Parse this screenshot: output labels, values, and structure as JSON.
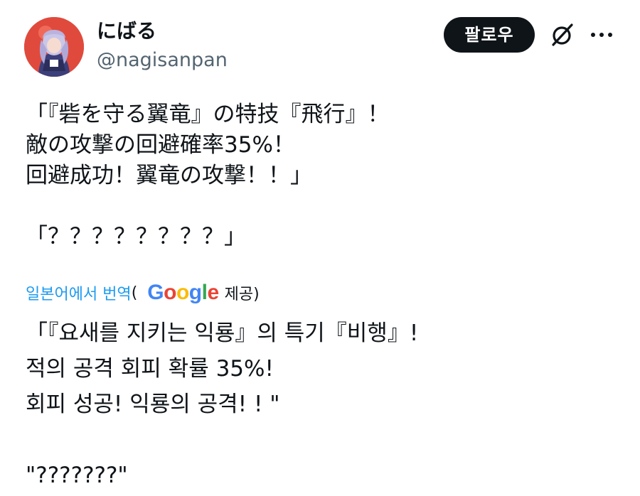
{
  "user": {
    "display_name": "にばる",
    "handle": "@nagisanpan"
  },
  "actions": {
    "follow_label": "팔로우",
    "grok_icon": "grok-slash-icon",
    "more_icon": "more-horizontal-icon"
  },
  "tweet": {
    "lines": [
      "「『砦を守る翼竜』の特技『飛行』！",
      "敵の攻撃の回避確率35%！",
      "回避成功！翼竜の攻撃！！」",
      "",
      "「？？？？？？？？」"
    ]
  },
  "translation": {
    "link_label": "일본어에서 번역",
    "open_paren": "(",
    "provider": "Google",
    "provided_label": "제공)",
    "lines": [
      "「『요새를 지키는 익룡』의 특기『비행』!",
      "적의 공격 회피 확률 35%!",
      "회피 성공! 익룡의 공격! ! \"",
      "",
      "\"???????\""
    ]
  },
  "colors": {
    "text": "#0f1419",
    "secondary": "#536471",
    "link": "#1d9bf0",
    "follow_bg": "#0f1419"
  }
}
